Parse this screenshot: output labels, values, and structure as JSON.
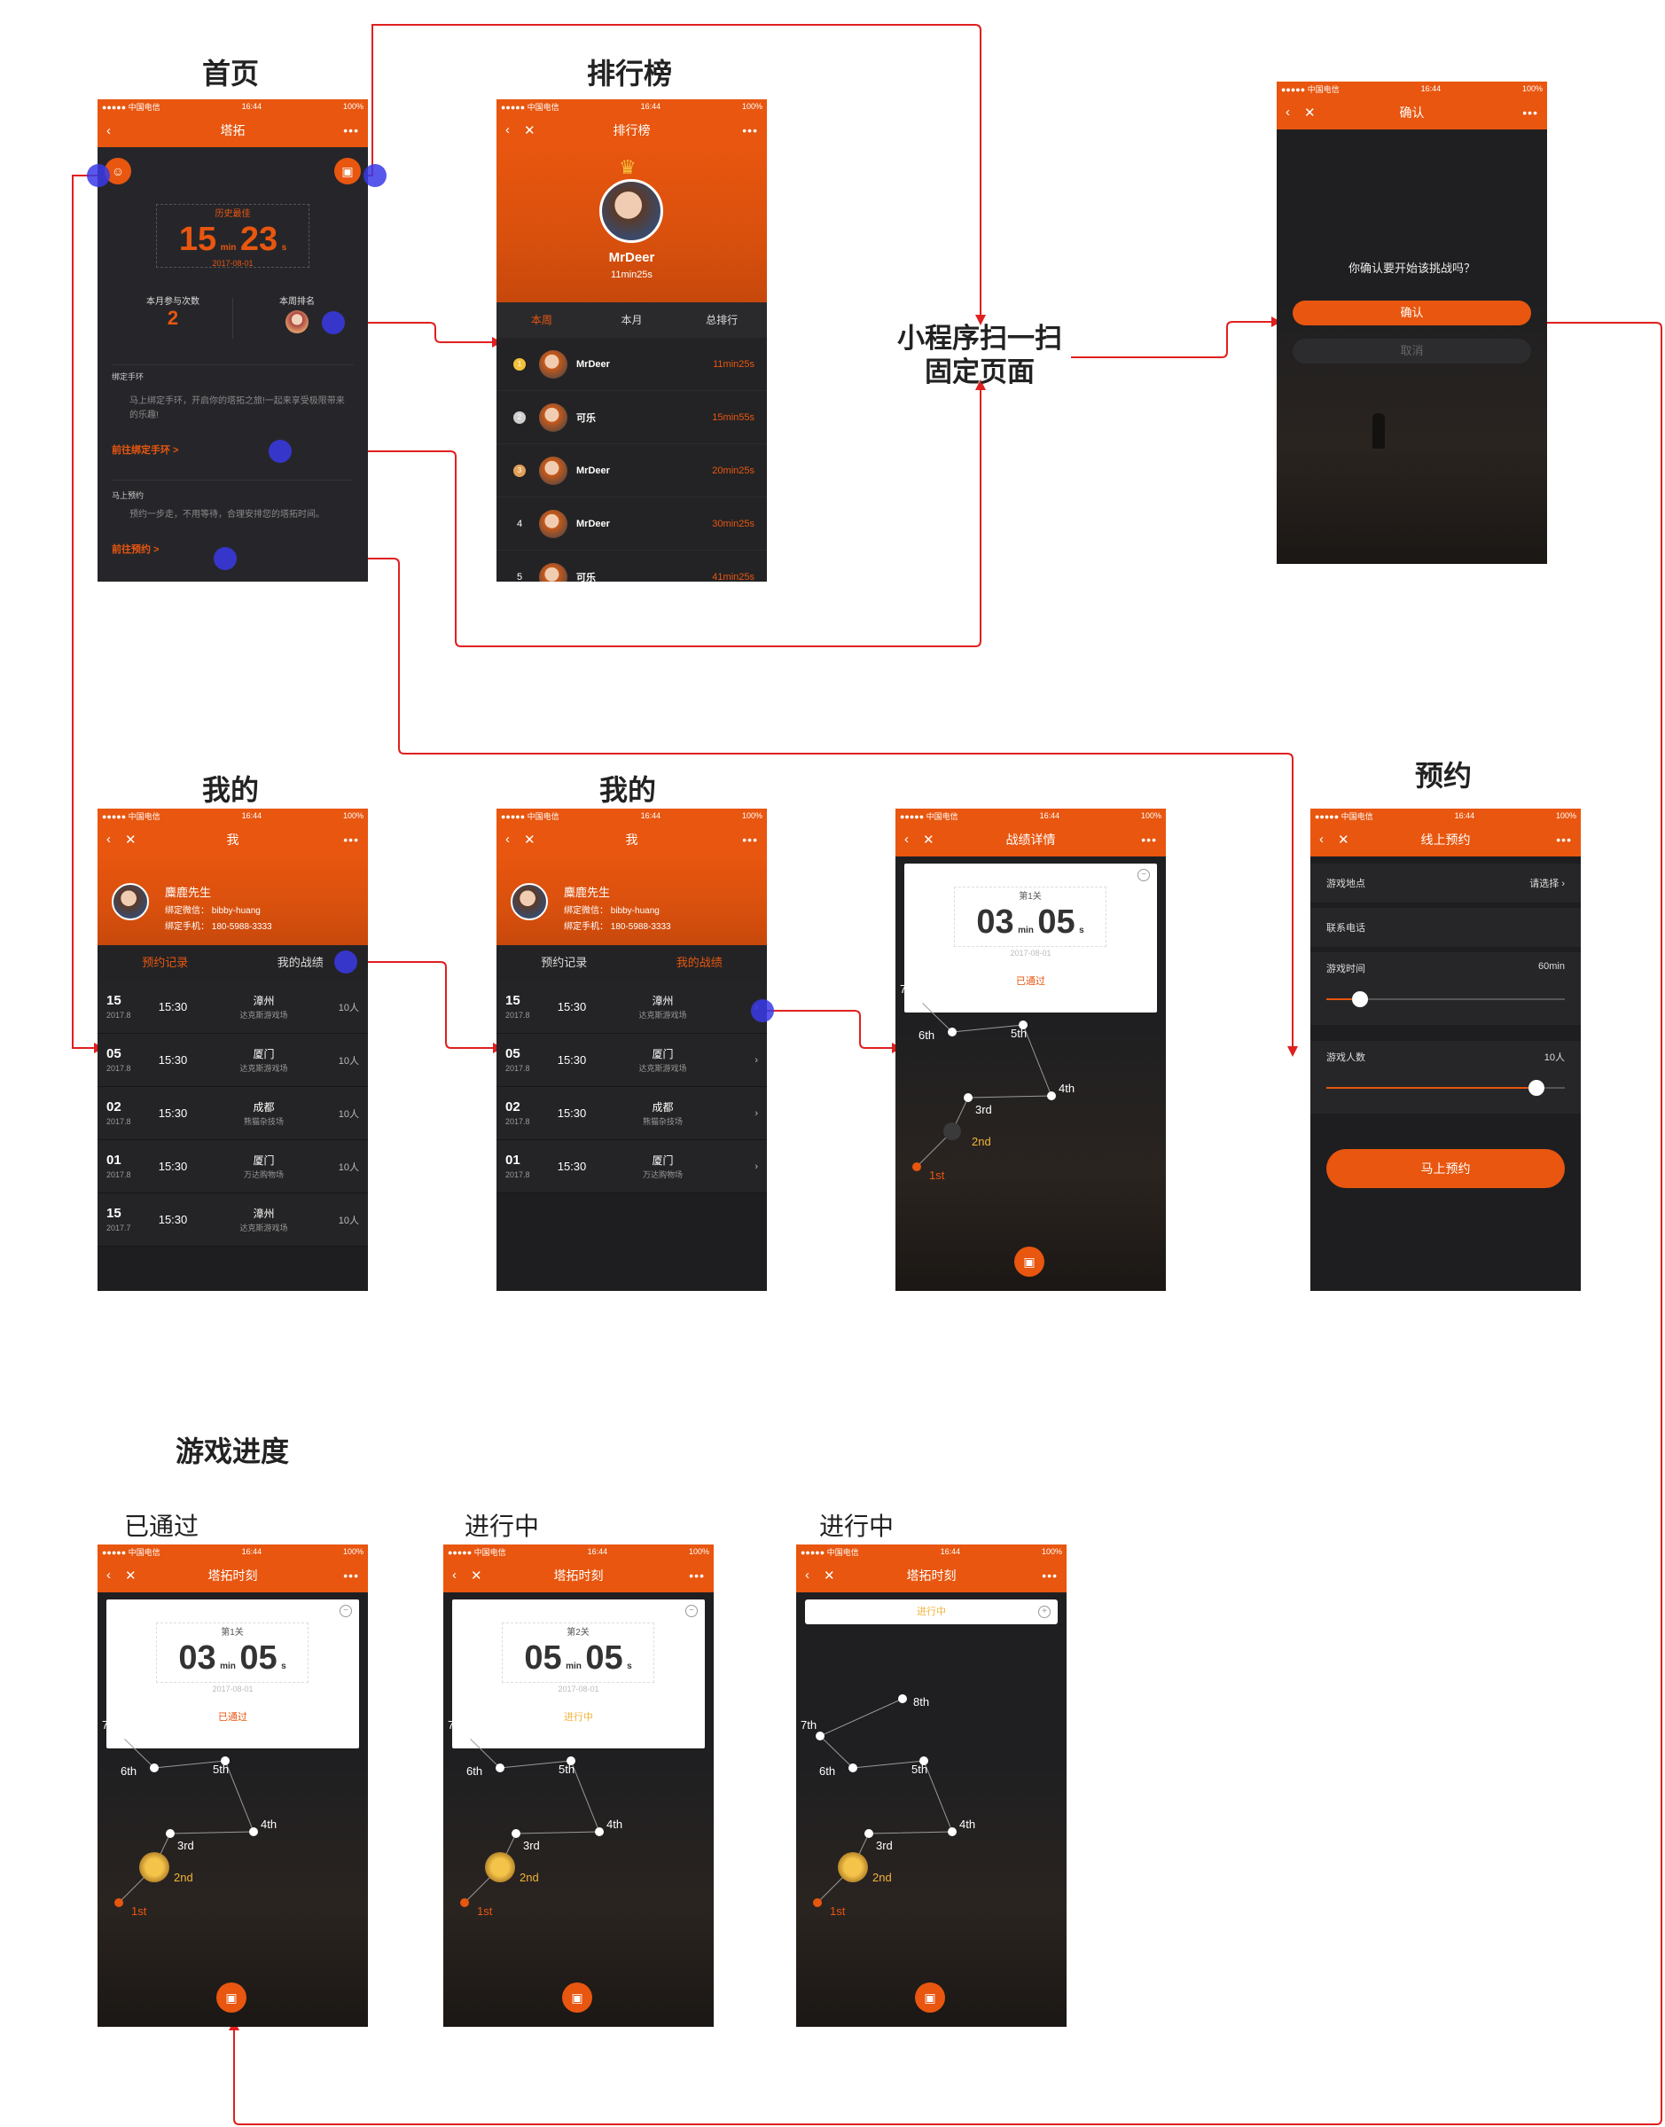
{
  "labels": {
    "home": "首页",
    "ranking": "排行榜",
    "mine_a": "我的",
    "mine_b": "我的",
    "booking": "预约",
    "progress": "游戏进度",
    "passed": "已通过",
    "in_progress_a": "进行中",
    "in_progress_b": "进行中",
    "scan_note_1": "小程序扫一扫",
    "scan_note_2": "固定页面"
  },
  "status": {
    "carrier": "●●●●● 中国电信",
    "time": "16:44",
    "battery": "100%"
  },
  "home": {
    "nav_title": "塔拓",
    "best_label": "历史最佳",
    "best_min": "15",
    "best_sec": "23",
    "unit_min": "min",
    "unit_sec": "s",
    "best_date": "2017-08-01",
    "month_count_label": "本月参与次数",
    "month_count": "2",
    "week_rank_label": "本周排名",
    "bind_title": "绑定手环",
    "bind_desc": "马上绑定手环，开启你的塔拓之旅!一起来享受极限带来的乐趣!",
    "bind_link": "前往绑定手环 >",
    "book_title": "马上预约",
    "book_desc": "预约一步走，不用等待，合理安排您的塔拓时间。",
    "book_link": "前往预约 >"
  },
  "ranking": {
    "nav_title": "排行榜",
    "top_name": "MrDeer",
    "top_time": "11min25s",
    "tabs": [
      "本周",
      "本月",
      "总排行"
    ],
    "rows": [
      {
        "rank": "1",
        "name": "MrDeer",
        "time": "11min25s"
      },
      {
        "rank": "2",
        "name": "可乐",
        "time": "15min55s"
      },
      {
        "rank": "3",
        "name": "MrDeer",
        "time": "20min25s"
      },
      {
        "rank": "4",
        "name": "MrDeer",
        "time": "30min25s"
      },
      {
        "rank": "5",
        "name": "可乐",
        "time": "41min25s"
      }
    ]
  },
  "confirm": {
    "nav_title": "确认",
    "question": "你确认要开始该挑战吗？",
    "ok": "确认",
    "cancel": "取消"
  },
  "mine": {
    "nav_title": "我",
    "name": "麋鹿先生",
    "wechat": "绑定微信： bibby-huang",
    "phone": "绑定手机： 180-5988-3333",
    "tab_records": "预约记录",
    "tab_scores": "我的战绩",
    "rows_a": [
      {
        "day": "15",
        "ym": "2017.8",
        "time": "15:30",
        "city": "漳州",
        "venue": "达克斯游戏场",
        "ppl": "10人"
      },
      {
        "day": "05",
        "ym": "2017.8",
        "time": "15:30",
        "city": "厦门",
        "venue": "达克斯游戏场",
        "ppl": "10人"
      },
      {
        "day": "02",
        "ym": "2017.8",
        "time": "15:30",
        "city": "成都",
        "venue": "熊猫杂技场",
        "ppl": "10人"
      },
      {
        "day": "01",
        "ym": "2017.8",
        "time": "15:30",
        "city": "厦门",
        "venue": "万达购物场",
        "ppl": "10人"
      },
      {
        "day": "15",
        "ym": "2017.7",
        "time": "15:30",
        "city": "漳州",
        "venue": "达克斯游戏场",
        "ppl": "10人"
      }
    ],
    "rows_b": [
      {
        "day": "15",
        "ym": "2017.8",
        "time": "15:30",
        "city": "漳州",
        "venue": "达克斯游戏场"
      },
      {
        "day": "05",
        "ym": "2017.8",
        "time": "15:30",
        "city": "厦门",
        "venue": "达克斯游戏场"
      },
      {
        "day": "02",
        "ym": "2017.8",
        "time": "15:30",
        "city": "成都",
        "venue": "熊猫杂技场"
      },
      {
        "day": "01",
        "ym": "2017.8",
        "time": "15:30",
        "city": "厦门",
        "venue": "万达购物场"
      }
    ]
  },
  "detail": {
    "nav_title": "战绩详情",
    "stage": "第1关",
    "min": "03",
    "sec": "05",
    "date": "2017-08-01",
    "state": "已通过"
  },
  "book": {
    "nav_title": "线上预约",
    "place_label": "游戏地点",
    "place_value": "请选择",
    "phone_label": "联系电话",
    "duration_label": "游戏时间",
    "duration_value": "60min",
    "duration_level": 0.14,
    "people_label": "游戏人数",
    "people_value": "10人",
    "people_level": 0.88,
    "submit": "马上预约"
  },
  "progress": {
    "nav_title": "塔拓时刻",
    "cards": [
      {
        "stage": "第1关",
        "min": "03",
        "sec": "05",
        "date": "2017-08-01",
        "state": "已通过",
        "state_color": "#e8560f"
      },
      {
        "stage": "第2关",
        "min": "05",
        "sec": "05",
        "date": "2017-08-01",
        "state": "进行中",
        "state_color": "#f0b43a"
      }
    ],
    "bar_state": "进行中",
    "nodes": [
      "1st",
      "2nd",
      "3rd",
      "4th",
      "5th",
      "6th",
      "7th",
      "8th"
    ]
  },
  "colors": {
    "accent": "#e8560f",
    "flow_line": "#e02020",
    "marker": "#3a3ae8",
    "gold": "#f0b43a"
  }
}
